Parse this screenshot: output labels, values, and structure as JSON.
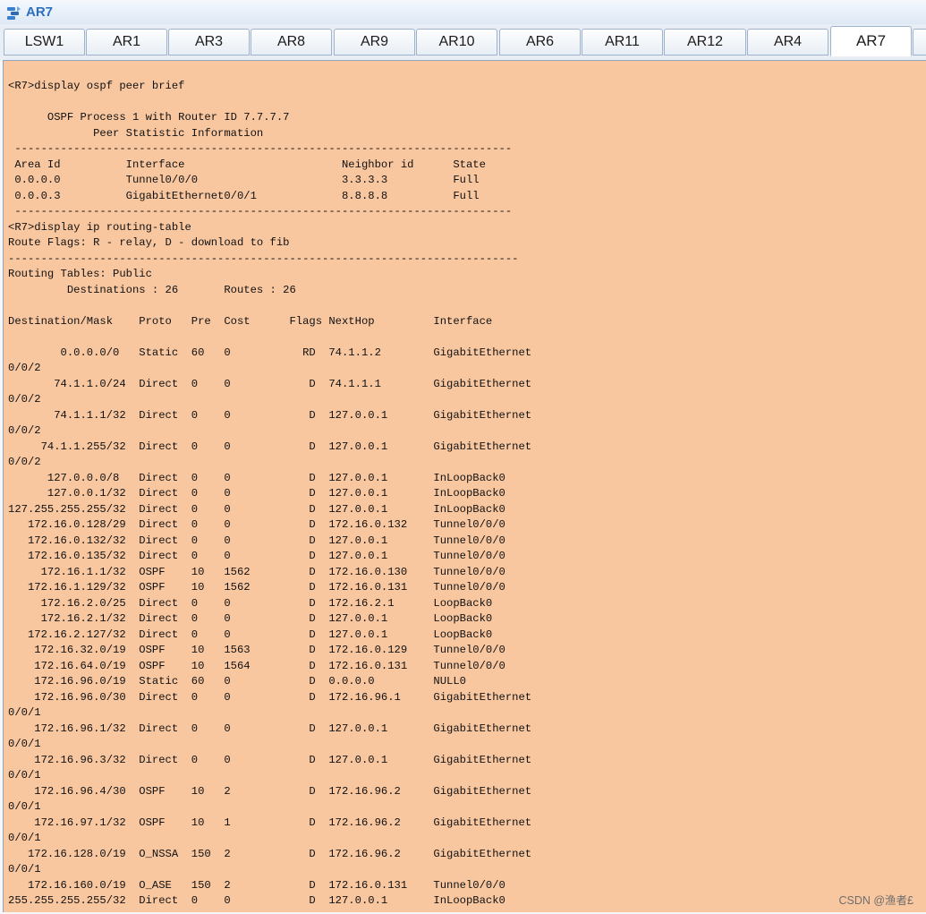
{
  "window": {
    "title": "AR7"
  },
  "tabs": [
    {
      "label": "LSW1",
      "active": false
    },
    {
      "label": "AR1",
      "active": false
    },
    {
      "label": "AR3",
      "active": false
    },
    {
      "label": "AR8",
      "active": false
    },
    {
      "label": "AR9",
      "active": false
    },
    {
      "label": "AR10",
      "active": false
    },
    {
      "label": "AR6",
      "active": false
    },
    {
      "label": "AR11",
      "active": false
    },
    {
      "label": "AR12",
      "active": false
    },
    {
      "label": "AR4",
      "active": false
    },
    {
      "label": "AR7",
      "active": true
    }
  ],
  "terminal": {
    "lines": [
      "<R7>display ospf peer brief",
      "",
      "      OSPF Process 1 with Router ID 7.7.7.7",
      "             Peer Statistic Information",
      " ----------------------------------------------------------------------------",
      " Area Id          Interface                        Neighbor id      State",
      " 0.0.0.0          Tunnel0/0/0                      3.3.3.3          Full",
      " 0.0.0.3          GigabitEthernet0/0/1             8.8.8.8          Full",
      " ----------------------------------------------------------------------------",
      "<R7>display ip routing-table",
      "Route Flags: R - relay, D - download to fib",
      "------------------------------------------------------------------------------",
      "Routing Tables: Public",
      "         Destinations : 26       Routes : 26",
      "",
      "Destination/Mask    Proto   Pre  Cost      Flags NextHop         Interface",
      "",
      "        0.0.0.0/0   Static  60   0           RD  74.1.1.2        GigabitEthernet",
      "0/0/2",
      "       74.1.1.0/24  Direct  0    0            D  74.1.1.1        GigabitEthernet",
      "0/0/2",
      "       74.1.1.1/32  Direct  0    0            D  127.0.0.1       GigabitEthernet",
      "0/0/2",
      "     74.1.1.255/32  Direct  0    0            D  127.0.0.1       GigabitEthernet",
      "0/0/2",
      "      127.0.0.0/8   Direct  0    0            D  127.0.0.1       InLoopBack0",
      "      127.0.0.1/32  Direct  0    0            D  127.0.0.1       InLoopBack0",
      "127.255.255.255/32  Direct  0    0            D  127.0.0.1       InLoopBack0",
      "   172.16.0.128/29  Direct  0    0            D  172.16.0.132    Tunnel0/0/0",
      "   172.16.0.132/32  Direct  0    0            D  127.0.0.1       Tunnel0/0/0",
      "   172.16.0.135/32  Direct  0    0            D  127.0.0.1       Tunnel0/0/0",
      "     172.16.1.1/32  OSPF    10   1562         D  172.16.0.130    Tunnel0/0/0",
      "   172.16.1.129/32  OSPF    10   1562         D  172.16.0.131    Tunnel0/0/0",
      "     172.16.2.0/25  Direct  0    0            D  172.16.2.1      LoopBack0",
      "     172.16.2.1/32  Direct  0    0            D  127.0.0.1       LoopBack0",
      "   172.16.2.127/32  Direct  0    0            D  127.0.0.1       LoopBack0",
      "    172.16.32.0/19  OSPF    10   1563         D  172.16.0.129    Tunnel0/0/0",
      "    172.16.64.0/19  OSPF    10   1564         D  172.16.0.131    Tunnel0/0/0",
      "    172.16.96.0/19  Static  60   0            D  0.0.0.0         NULL0",
      "    172.16.96.0/30  Direct  0    0            D  172.16.96.1     GigabitEthernet",
      "0/0/1",
      "    172.16.96.1/32  Direct  0    0            D  127.0.0.1       GigabitEthernet",
      "0/0/1",
      "    172.16.96.3/32  Direct  0    0            D  127.0.0.1       GigabitEthernet",
      "0/0/1",
      "    172.16.96.4/30  OSPF    10   2            D  172.16.96.2     GigabitEthernet",
      "0/0/1",
      "    172.16.97.1/32  OSPF    10   1            D  172.16.96.2     GigabitEthernet",
      "0/0/1",
      "   172.16.128.0/19  O_NSSA  150  2            D  172.16.96.2     GigabitEthernet",
      "0/0/1",
      "   172.16.160.0/19  O_ASE   150  2            D  172.16.0.131    Tunnel0/0/0",
      "255.255.255.255/32  Direct  0    0            D  127.0.0.1       InLoopBack0"
    ]
  },
  "watermark": "CSDN @渔者£"
}
